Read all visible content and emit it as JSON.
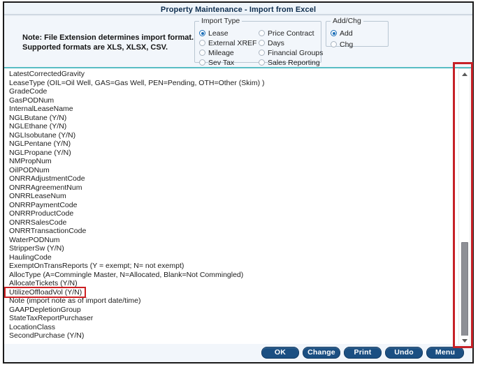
{
  "window": {
    "title": "Property Maintenance - Import from Excel"
  },
  "note": {
    "line1": "Note: File Extension determines import format.",
    "line2": "Supported formats are XLS, XLSX, CSV."
  },
  "import_type": {
    "legend": "Import Type",
    "selected": "Lease",
    "column1": [
      {
        "label": "Lease",
        "checked": true
      },
      {
        "label": "External XREF",
        "checked": false
      },
      {
        "label": "Mileage",
        "checked": false
      },
      {
        "label": "Sev Tax",
        "checked": false
      }
    ],
    "column2": [
      {
        "label": "Price Contract",
        "checked": false
      },
      {
        "label": "Days",
        "checked": false
      },
      {
        "label": "Financial Groups",
        "checked": false
      },
      {
        "label": "Sales Reporting",
        "checked": false
      }
    ]
  },
  "add_chg": {
    "legend": "Add/Chg",
    "selected": "Add",
    "options": [
      {
        "label": "Add",
        "checked": true
      },
      {
        "label": "Chg",
        "checked": false
      }
    ]
  },
  "field_list": {
    "highlighted_item": "UtilizeOffloadVol (Y/N)",
    "items": [
      "LatestCorrectedGravity",
      "LeaseType (OIL=Oil Well, GAS=Gas Well, PEN=Pending, OTH=Other (Skim) )",
      "GradeCode",
      "GasPODNum",
      "InternalLeaseName",
      "NGLButane (Y/N)",
      "NGLEthane (Y/N)",
      "NGLIsobutane (Y/N)",
      "NGLPentane (Y/N)",
      "NGLPropane (Y/N)",
      "NMPropNum",
      "OilPODNum",
      "ONRRAdjustmentCode",
      "ONRRAgreementNum",
      "ONRRLeaseNum",
      "ONRRPaymentCode",
      "ONRRProductCode",
      "ONRRSalesCode",
      "ONRRTransactionCode",
      "WaterPODNum",
      "StripperSw (Y/N)",
      "HaulingCode",
      "ExemptOnTransReports (Y = exempt; N= not exempt)",
      "AllocType (A=Commingle Master, N=Allocated, Blank=Not Commingled)",
      "AllocateTickets (Y/N)",
      "UtilizeOffloadVol (Y/N)",
      "Note (import note as of import date/time)",
      "GAAPDepletionGroup",
      "StateTaxReportPurchaser",
      "LocationClass",
      "SecondPurchase (Y/N)"
    ]
  },
  "scrollbar": {
    "up_arrow": "scroll-up-arrow",
    "down_arrow": "scroll-down-arrow"
  },
  "buttons": [
    {
      "label": "OK"
    },
    {
      "label": "Change"
    },
    {
      "label": "Print"
    },
    {
      "label": "Undo"
    },
    {
      "label": "Menu"
    }
  ],
  "colors": {
    "button_blue": "#1b4f82",
    "accent_teal": "#4fb9c2",
    "annotation_red": "#c62127",
    "panel_bg": "#f2f6fb",
    "title_text": "#0d2d4e"
  }
}
